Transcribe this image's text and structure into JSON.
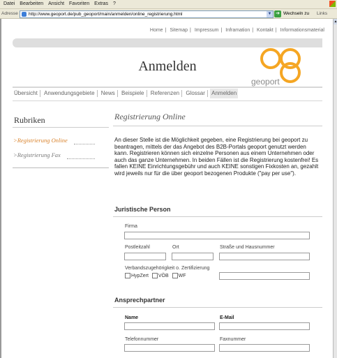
{
  "browser": {
    "menu": [
      "Datei",
      "Bearbeiten",
      "Ansicht",
      "Favoriten",
      "Extras",
      "?"
    ],
    "address_label": "Adresse",
    "url": "http://www.geoport.de/pub_geoport/main/anmelden/online_registrierung.html",
    "go_label": "Wechseln zu",
    "links_label": "Links"
  },
  "topnav": [
    "Home",
    "Sitemap",
    "Impressum",
    "Inframation",
    "Kontakt",
    "Informationsmaterial"
  ],
  "header": {
    "title": "Anmelden",
    "logo_text": "geoport",
    "logo_color": "#f5a623"
  },
  "tabs": [
    {
      "label": "Übersicht",
      "active": false
    },
    {
      "label": "Anwendungsgebiete",
      "active": false
    },
    {
      "label": "News",
      "active": false
    },
    {
      "label": "Beispiele",
      "active": false
    },
    {
      "label": "Referenzen",
      "active": false
    },
    {
      "label": "Glossar",
      "active": false
    },
    {
      "label": "Anmelden",
      "active": true
    }
  ],
  "sidebar": {
    "title": "Rubriken",
    "items": [
      {
        "label": ">Registrierung Online",
        "active": true,
        "color": "#d9822b"
      },
      {
        "label": ">Registrierung Fax",
        "active": false,
        "color": "#777777"
      }
    ]
  },
  "main": {
    "title": "Registrierung Online",
    "intro": "An dieser Stelle ist die Möglichkeit gegeben, eine Registrierung bei geoport zu beantragen, mittels der das Angebot des B2B-Portals geoport genutzt werden kann. Registrieren können sich einzelne Personen aus einem Unternehmen oder auch das ganze Unternehmen. In beiden Fällen ist die Registrierung kostenfrei! Es fallen KEINE Einrichtungsgebühr und auch KEINE sonstigen Fixkosten an, gezahlt wird jeweils nur für die über geoport bezogenen Produkte (\"pay per use\").",
    "section1": {
      "title": "Juristische Person",
      "firma_label": "Firma",
      "plz_label": "Postleitzahl",
      "ort_label": "Ort",
      "strasse_label": "Straße und Hausnummer",
      "verband_label": "Verbandszugehörigkeit o. Zertifizierung",
      "checkboxes": [
        "HypZert",
        "VÖB",
        "WF"
      ]
    },
    "section2": {
      "title": "Ansprechpartner",
      "name_label": "Name",
      "email_label": "E-Mail",
      "telefon_label": "Telefonnummer",
      "fax_label": "Faxnummer"
    }
  }
}
